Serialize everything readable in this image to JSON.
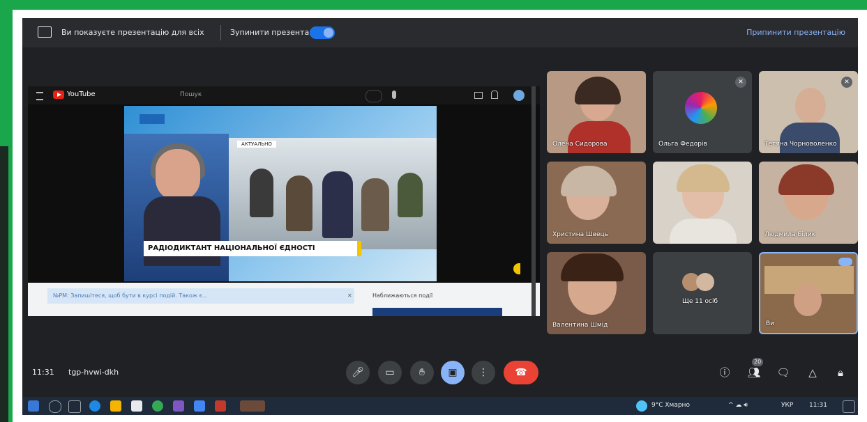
{
  "meet": {
    "sharing_text": "Ви показуєте презентацію для всіх",
    "stop_show_text": "Зупинити презентацію",
    "stop_link": "Припинити презентацію",
    "time": "11:31",
    "meeting_code": "tgp-hvwi-dkh"
  },
  "presentation": {
    "youtube_name": "YouTube",
    "search_placeholder": "Пошук",
    "video_tag": "АКТУАЛЬНО",
    "caption": "РАДІОДИКТАНТ НАЦІОНАЛЬНОЇ ЄДНОСТІ",
    "field_text": "№PМ: Запишітеся, щоб бути в курсі подій. Також є...",
    "side_text": "Наближаються події"
  },
  "participants": [
    {
      "name": "Олена Сидорова",
      "color": "#c9a58c",
      "muted": false
    },
    {
      "name": "Ольга Федорів",
      "color": "#3c4043",
      "muted": true
    },
    {
      "name": "Тетяна Чорноволенко",
      "color": "#b9a48e",
      "muted": true
    },
    {
      "name": "Христина Швець",
      "color": "#b07a5e",
      "muted": false
    },
    {
      "name": "",
      "color": "#cbb8a6",
      "muted": false
    },
    {
      "name": "Людмила Білик",
      "color": "#9a7d6b",
      "muted": false
    },
    {
      "name": "Валентина Шмід",
      "color": "#a07e5c",
      "muted": false
    },
    {
      "name": "Ще 11 осіб",
      "color": "#3c4043",
      "muted": false
    },
    {
      "name": "Ви",
      "color": "#7a5a3a",
      "muted": false
    }
  ],
  "controls": {
    "mic_icon": "microphone-icon",
    "camera_icon": "camera-icon",
    "hand_icon": "raise-hand-icon",
    "present_icon": "present-icon",
    "more_icon": "more-options-icon",
    "leave_icon": "hang-up-icon"
  },
  "right_controls": {
    "info_icon": "info-icon",
    "people_count": "20",
    "people_icon": "people-icon",
    "chat_icon": "chat-icon",
    "activities_icon": "activities-icon",
    "lock_icon": "host-controls-icon"
  },
  "taskbar": {
    "weather": "9°C Хмарно",
    "clock": "11:31",
    "language": "УКР"
  }
}
